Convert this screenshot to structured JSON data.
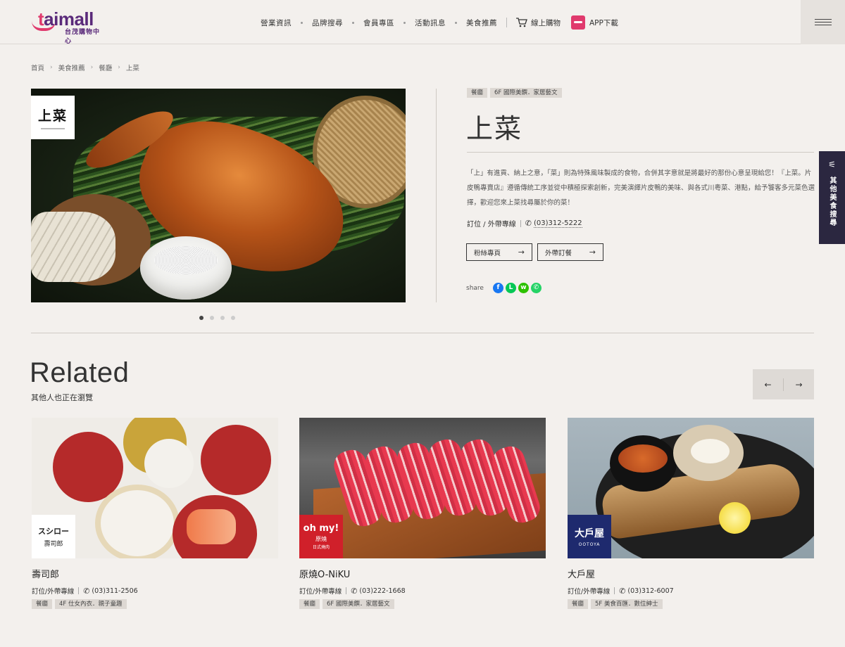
{
  "header": {
    "logo": {
      "main": "aimall",
      "accent_letter": "t",
      "sub": "台茂購物中心"
    },
    "nav": [
      "營業資訊",
      "品牌搜尋",
      "會員專區",
      "活動訊息",
      "美食推薦"
    ],
    "cart_label": "線上購物",
    "app_label": "APP下載"
  },
  "breadcrumb": [
    "首頁",
    "美食推薦",
    "餐廳",
    "上菜"
  ],
  "store": {
    "logo_text": "上菜",
    "tags": [
      "餐廳",
      "6F 國際美饌．家居藝文"
    ],
    "title": "上菜",
    "description": "「上」有進貢、納上之意，「菜」則為特殊風味製成的食物，合併其字意就是將最好的那份心意呈現給您！『上菜。片皮鴨專賣店』遵循傳統工序並從中積極探索創新，完美演繹片皮鴨的美味、與各式川粵菜、港點，給予饕客多元菜色選擇，歡迎您來上菜找尋屬於你的菜！",
    "reserve_label": "訂位 / 外帶專線",
    "phone": "(03)312-5222",
    "buttons": [
      "粉絲專頁",
      "外帶訂餐"
    ],
    "share_label": "share",
    "share_icons": [
      "facebook-icon",
      "line-icon",
      "wechat-icon",
      "whatsapp-icon"
    ],
    "carousel": {
      "count": 4,
      "active": 1
    }
  },
  "side_tab": {
    "label": "其他美食搜尋"
  },
  "related": {
    "title": "Related",
    "subtitle": "其他人也正在瀏覽",
    "cards": [
      {
        "name": "壽司郎",
        "logo_text": "スシロー",
        "logo_sub": "壽司郎",
        "reserve_label": "訂位/外帶專線",
        "phone": "(03)311-2506",
        "tags": [
          "餐廳",
          "4F 仕女內衣．親子童趣"
        ]
      },
      {
        "name": "原燒O-NiKU",
        "logo_text": "oh my!",
        "logo_sub": "原燒",
        "logo_sub2": "日式燒肉",
        "reserve_label": "訂位/外帶專線",
        "phone": "(03)222-1668",
        "tags": [
          "餐廳",
          "6F 國際美饌．家居藝文"
        ]
      },
      {
        "name": "大戶屋",
        "logo_text": "大戶屋",
        "logo_sub": "OOTOYA",
        "reserve_label": "訂位/外帶專線",
        "phone": "(03)312-6007",
        "tags": [
          "餐廳",
          "5F 美食百匯．數位紳士"
        ]
      }
    ]
  },
  "colors": {
    "background": "#f3f0ed",
    "brand_pink": "#e03a6d",
    "brand_purple": "#5a2a7a",
    "side_tab": "#2b2740",
    "facebook": "#1877f2",
    "line": "#06c755",
    "wechat": "#2dc100",
    "whatsapp": "#25d366"
  }
}
